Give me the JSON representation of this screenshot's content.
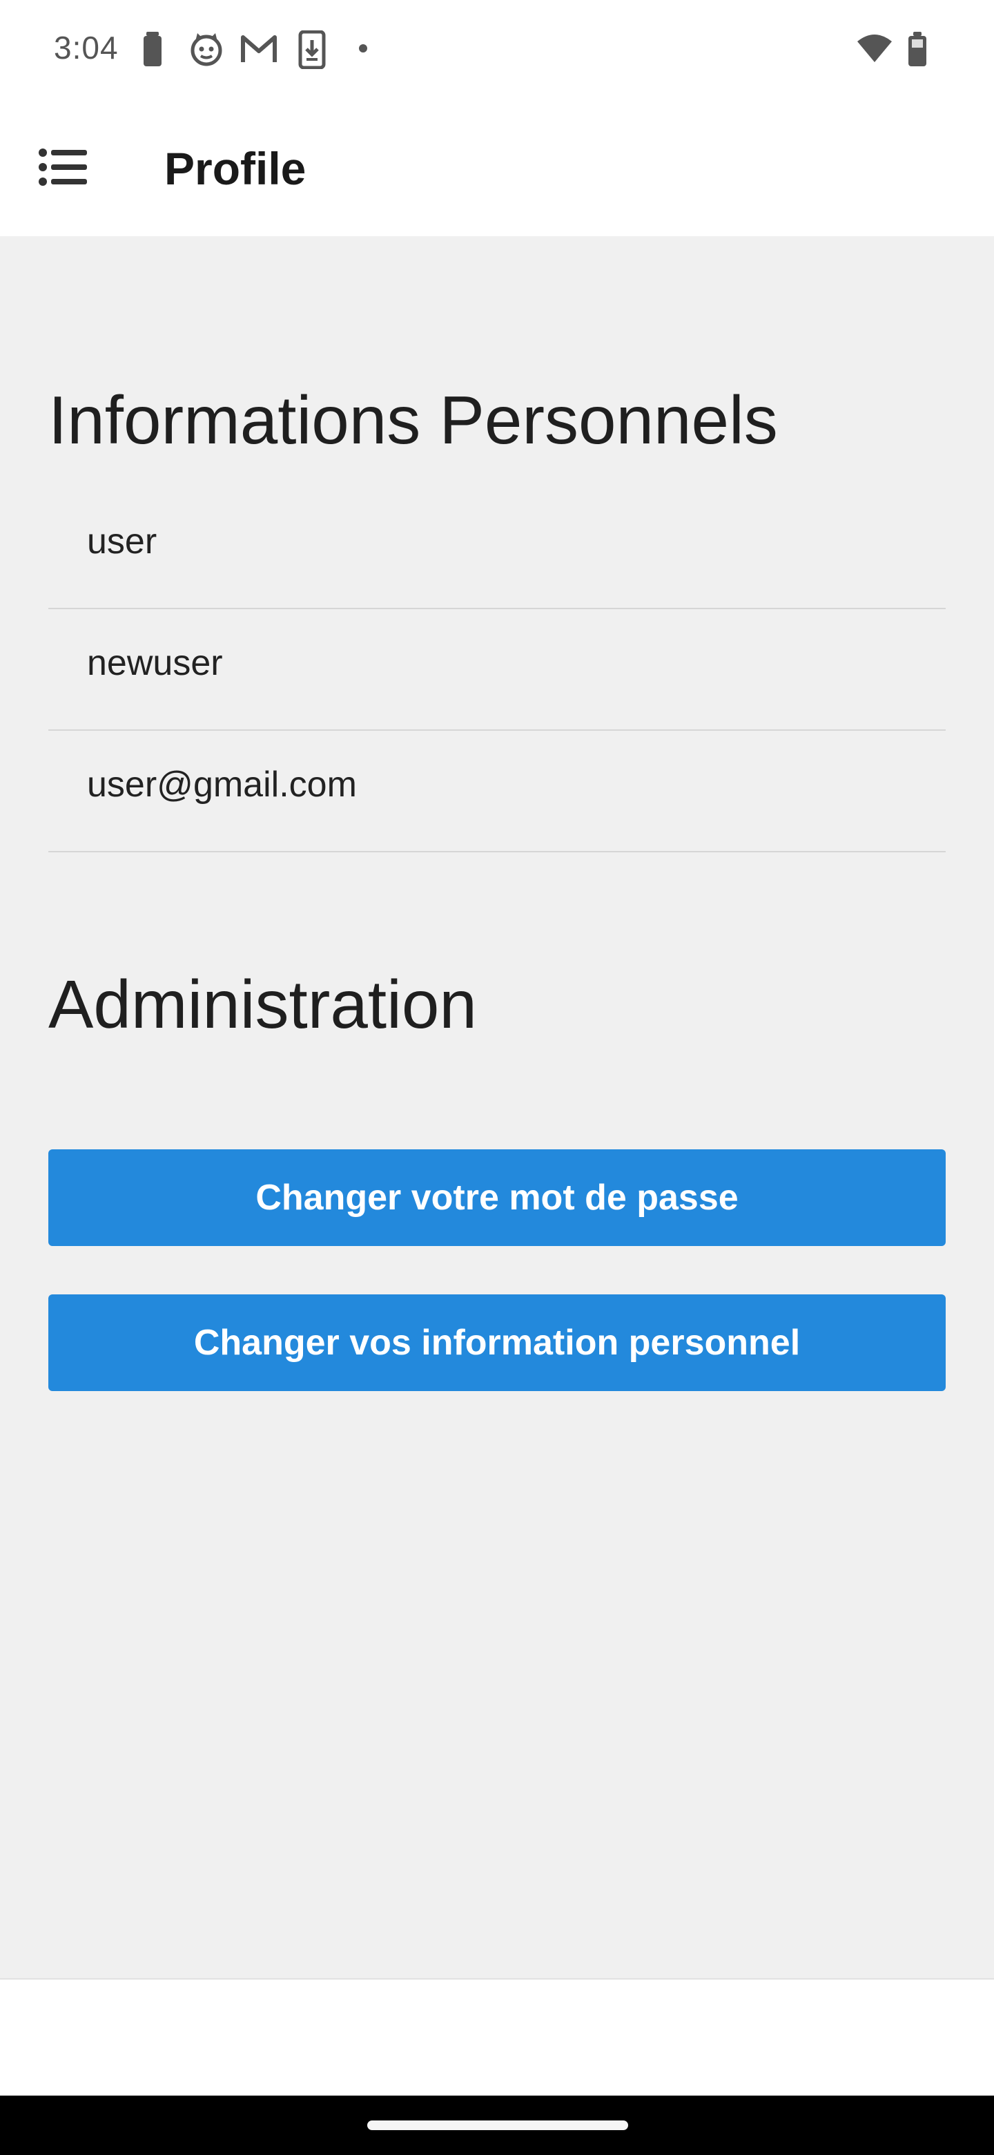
{
  "status_bar": {
    "time": "3:04",
    "left_icons": [
      "battery-saver-icon",
      "cat-face-icon",
      "gmail-icon",
      "download-phone-icon",
      "dot-icon"
    ],
    "right_icons": [
      "wifi-icon",
      "battery-icon"
    ]
  },
  "app_bar": {
    "menu_icon": "list-menu-icon",
    "title": "Profile"
  },
  "personal_info": {
    "title": "Informations Personnels",
    "fields": [
      "user",
      "newuser",
      "user@gmail.com"
    ]
  },
  "administration": {
    "title": "Administration",
    "change_password_label": "Changer votre mot de passe",
    "change_info_label": "Changer vos information personnel"
  },
  "colors": {
    "button_blue": "#2389dc",
    "background": "#f0f0f0"
  }
}
